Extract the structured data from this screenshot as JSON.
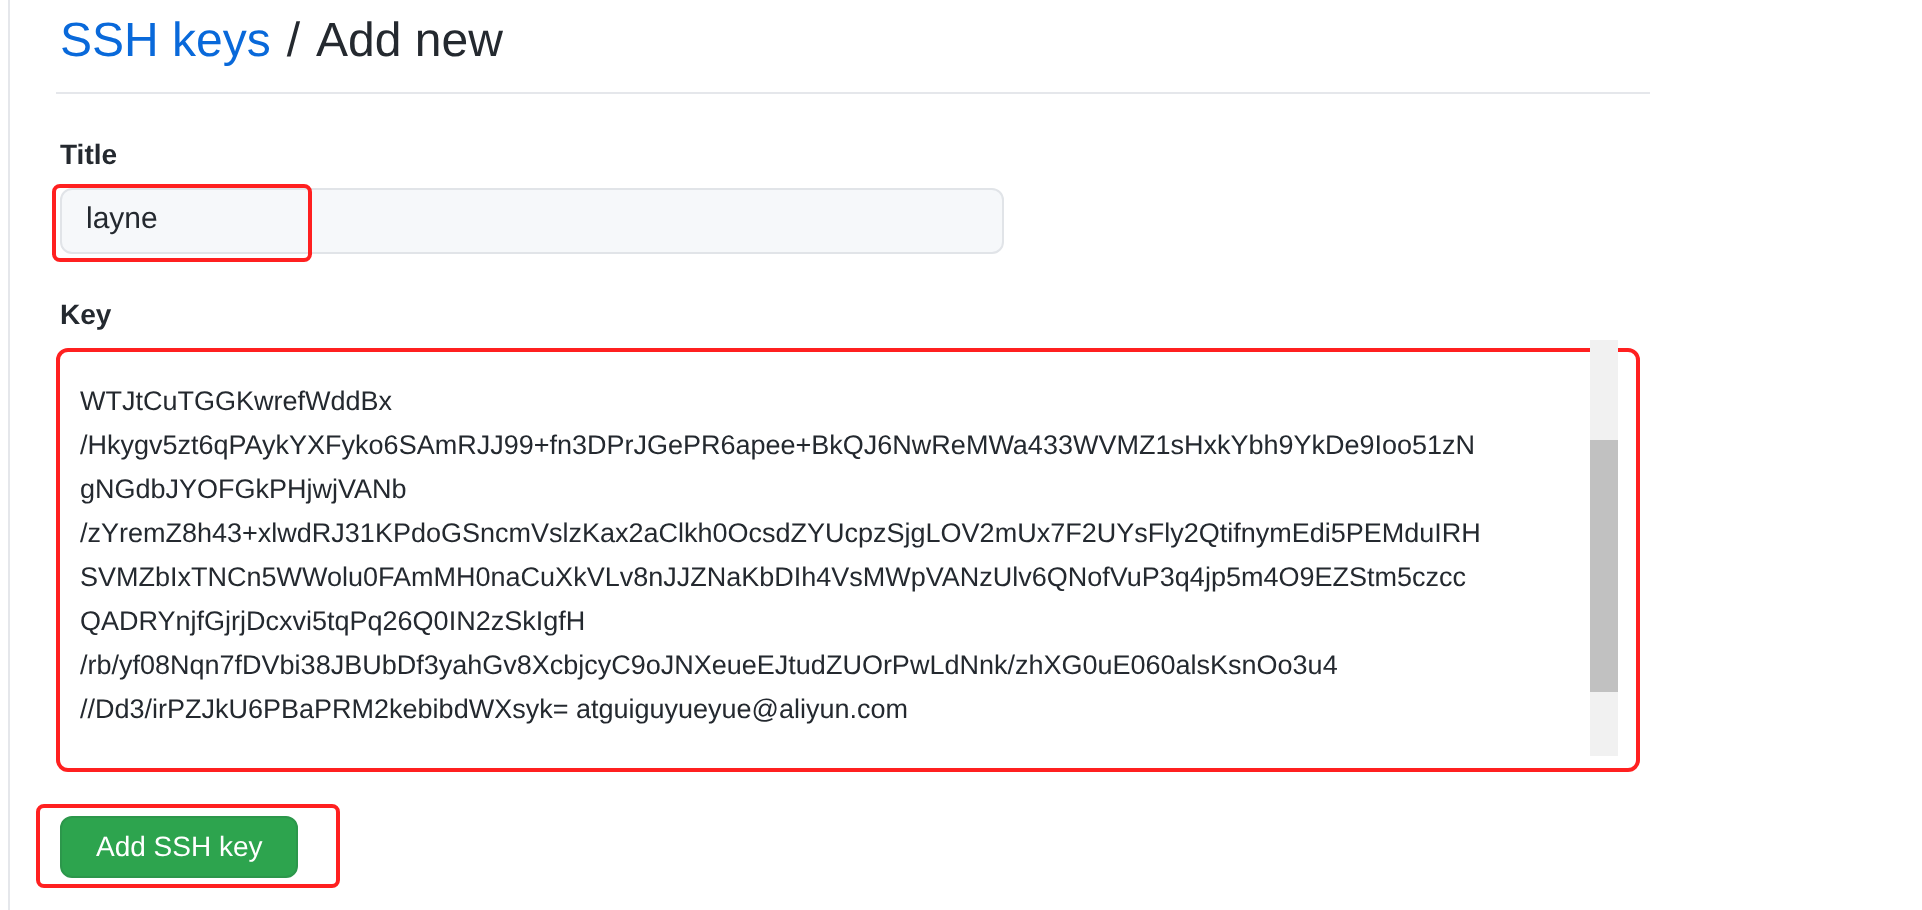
{
  "breadcrumb": {
    "link": "SSH keys",
    "separator": "/",
    "current": "Add new"
  },
  "fields": [
    {
      "kind": "input",
      "label": "Title",
      "value": "layne",
      "highlighted": true
    },
    {
      "kind": "textarea",
      "label": "Key",
      "value": "WTJtCuTGGKwrefWddBx\n/Hkygv5zt6qPAykYXFyko6SAmRJJ99+fn3DPrJGePR6apee+BkQJ6NwReMWa433WVMZ1sHxkYbh9YkDe9Ioo51zN\ngNGdbJYOFGkPHjwjVANb\n/zYremZ8h43+xlwdRJ31KPdoGSncmVslzKax2aClkh0OcsdZYUcpzSjgLOV2mUx7F2UYsFly2QtifnymEdi5PEMduIRH\nSVMZbIxTNCn5WWolu0FAmMH0naCuXkVLv8nJJZNaKbDIh4VsMWpVANzUlv6QNofVuP3q4jp5m4O9EZStm5czcc\nQADRYnjfGjrjDcxvi5tqPq26Q0IN2zSkIgfH\n/rb/yf08Nqn7fDVbi38JBUbDf3yahGv8XcbjcyC9oJNXeueEJtudZUOrPwLdNnk/zhXG0uE060alsKsnOo3u4\n//Dd3/irPZJkU6PBaPRM2kebibdWXsyk= atguiguyueyue@aliyun.com",
      "highlighted": true
    }
  ],
  "submit": {
    "label": "Add SSH key",
    "highlighted": true
  }
}
